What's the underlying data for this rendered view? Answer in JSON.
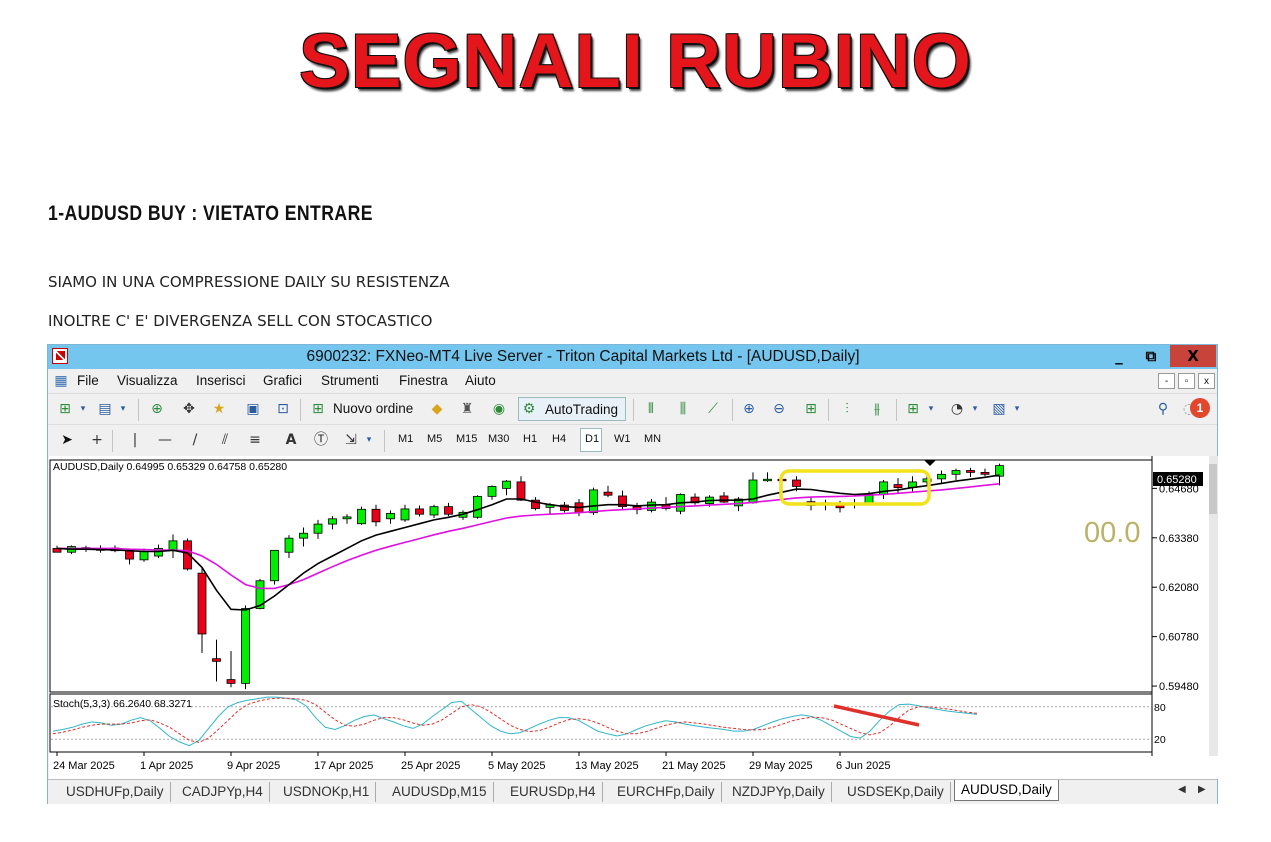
{
  "banner": "SEGNALI RUBINO",
  "heading": "1-AUDUSD BUY : VIETATO ENTRARE",
  "paragraphs": [
    "SIAMO IN UNA COMPRESSIONE DAILY SU RESISTENZA",
    "INOLTRE C' E' DIVERGENZA SELL CON STOCASTICO"
  ],
  "window": {
    "title": "6900232: FXNeo-MT4 Live Server - Triton Capital Markets Ltd - [AUDUSD,Daily]",
    "controls": {
      "minimize": "_",
      "restore": "⧉",
      "close": "X"
    },
    "menu": [
      "File",
      "Visualizza",
      "Inserisci",
      "Grafici",
      "Strumenti",
      "Finestra",
      "Aiuto"
    ],
    "mdi": {
      "minimize": "-",
      "restore": "▫",
      "close": "x"
    },
    "toolbar": {
      "new_order": "Nuovo ordine",
      "autotrading": "AutoTrading",
      "notification_count": "1"
    },
    "timeframes": [
      "M1",
      "M5",
      "M15",
      "M30",
      "H1",
      "H4",
      "D1",
      "W1",
      "MN"
    ],
    "active_timeframe": "D1",
    "tabs": [
      "USDHUFp,Daily",
      "CADJPYp,H4",
      "USDNOKp,H1",
      "AUDUSDp,M15",
      "EURUSDp,H4",
      "EURCHFp,Daily",
      "NZDJPYp,Daily",
      "USDSEKp,Daily",
      "AUDUSD,Daily"
    ],
    "active_tab": "AUDUSD,Daily"
  },
  "chart_data": {
    "type": "candlestick",
    "symbol_header": "AUDUSD,Daily  0.64995 0.65329 0.64758 0.65280",
    "current_price": "0.65280",
    "overlay_text": "00.0",
    "y_ticks": [
      "0.64680",
      "0.63380",
      "0.62080",
      "0.60780",
      "0.59480"
    ],
    "y_tick_values": [
      0.6468,
      0.6338,
      0.6208,
      0.6078,
      0.5948
    ],
    "ylim": [
      0.5935,
      0.654
    ],
    "x_labels": [
      "24 Mar 2025",
      "1 Apr 2025",
      "9 Apr 2025",
      "17 Apr 2025",
      "25 Apr 2025",
      "5 May 2025",
      "13 May 2025",
      "21 May 2025",
      "29 May 2025",
      "6 Jun 2025"
    ],
    "x_label_index": [
      0,
      6,
      12,
      18,
      24,
      30,
      36,
      42,
      48,
      54
    ],
    "candles": [
      [
        0.631,
        0.6317,
        0.63,
        0.63
      ],
      [
        0.63,
        0.6318,
        0.6295,
        0.6315
      ],
      [
        0.6307,
        0.6317,
        0.6301,
        0.6312
      ],
      [
        0.6305,
        0.6318,
        0.6299,
        0.631
      ],
      [
        0.6311,
        0.6318,
        0.63,
        0.6304
      ],
      [
        0.6304,
        0.6308,
        0.6268,
        0.6282
      ],
      [
        0.628,
        0.631,
        0.6275,
        0.6302
      ],
      [
        0.629,
        0.632,
        0.6285,
        0.631
      ],
      [
        0.6305,
        0.6347,
        0.6285,
        0.633
      ],
      [
        0.633,
        0.6336,
        0.6252,
        0.6256
      ],
      [
        0.6245,
        0.626,
        0.6035,
        0.6085
      ],
      [
        0.602,
        0.607,
        0.596,
        0.6013
      ],
      [
        0.5965,
        0.604,
        0.5945,
        0.5955
      ],
      [
        0.5955,
        0.616,
        0.594,
        0.6152
      ],
      [
        0.6152,
        0.623,
        0.615,
        0.6225
      ],
      [
        0.6225,
        0.63,
        0.6215,
        0.6305
      ],
      [
        0.63,
        0.6345,
        0.6285,
        0.6337
      ],
      [
        0.6337,
        0.6365,
        0.6315,
        0.635
      ],
      [
        0.635,
        0.6385,
        0.6335,
        0.6374
      ],
      [
        0.6374,
        0.6395,
        0.636,
        0.6388
      ],
      [
        0.6388,
        0.64,
        0.6375,
        0.6393
      ],
      [
        0.6375,
        0.642,
        0.6372,
        0.6413
      ],
      [
        0.6413,
        0.6425,
        0.6368,
        0.638
      ],
      [
        0.6388,
        0.641,
        0.6375,
        0.6402
      ],
      [
        0.6385,
        0.6425,
        0.638,
        0.6414
      ],
      [
        0.6414,
        0.6423,
        0.6394,
        0.64
      ],
      [
        0.6398,
        0.6425,
        0.639,
        0.642
      ],
      [
        0.642,
        0.643,
        0.6395,
        0.64
      ],
      [
        0.6392,
        0.641,
        0.6385,
        0.6405
      ],
      [
        0.6392,
        0.645,
        0.6388,
        0.6447
      ],
      [
        0.6447,
        0.6476,
        0.6438,
        0.6473
      ],
      [
        0.6468,
        0.649,
        0.645,
        0.6487
      ],
      [
        0.6485,
        0.65,
        0.6435,
        0.6437
      ],
      [
        0.6437,
        0.6445,
        0.641,
        0.6415
      ],
      [
        0.6418,
        0.643,
        0.64,
        0.6425
      ],
      [
        0.6424,
        0.6432,
        0.6405,
        0.641
      ],
      [
        0.643,
        0.644,
        0.6395,
        0.6405
      ],
      [
        0.6404,
        0.647,
        0.6398,
        0.6464
      ],
      [
        0.6458,
        0.6475,
        0.6445,
        0.645
      ],
      [
        0.6448,
        0.6462,
        0.641,
        0.642
      ],
      [
        0.642,
        0.643,
        0.64,
        0.6412
      ],
      [
        0.641,
        0.644,
        0.6405,
        0.6432
      ],
      [
        0.6425,
        0.6445,
        0.641,
        0.6415
      ],
      [
        0.6408,
        0.6455,
        0.64,
        0.6452
      ],
      [
        0.6445,
        0.6455,
        0.6425,
        0.643
      ],
      [
        0.6428,
        0.645,
        0.642,
        0.6445
      ],
      [
        0.6448,
        0.6458,
        0.643,
        0.6432
      ],
      [
        0.6422,
        0.6445,
        0.6408,
        0.644
      ],
      [
        0.643,
        0.651,
        0.6428,
        0.649
      ],
      [
        0.649,
        0.651,
        0.6485,
        0.6492
      ],
      [
        0.6492,
        0.6505,
        0.648,
        0.649
      ],
      [
        0.649,
        0.65,
        0.646,
        0.6473
      ],
      [
        0.6433,
        0.6445,
        0.641,
        0.6423
      ],
      [
        0.643,
        0.6438,
        0.641,
        0.6425
      ],
      [
        0.6425,
        0.6435,
        0.6405,
        0.6417
      ],
      [
        0.6425,
        0.644,
        0.6415,
        0.6428
      ],
      [
        0.6428,
        0.646,
        0.6425,
        0.6452
      ],
      [
        0.6452,
        0.649,
        0.644,
        0.6485
      ],
      [
        0.6478,
        0.6495,
        0.6455,
        0.647
      ],
      [
        0.647,
        0.65,
        0.646,
        0.6485
      ],
      [
        0.6485,
        0.6505,
        0.6475,
        0.6493
      ],
      [
        0.6493,
        0.6515,
        0.648,
        0.6505
      ],
      [
        0.6505,
        0.652,
        0.649,
        0.6515
      ],
      [
        0.6515,
        0.6522,
        0.6498,
        0.651
      ],
      [
        0.651,
        0.652,
        0.65,
        0.6505
      ],
      [
        0.65,
        0.6533,
        0.6476,
        0.6528
      ]
    ],
    "ma_black": [
      0.631,
      0.6308,
      0.6308,
      0.6307,
      0.6306,
      0.6304,
      0.6302,
      0.6302,
      0.6305,
      0.6298,
      0.626,
      0.62,
      0.615,
      0.6148,
      0.616,
      0.6185,
      0.6215,
      0.6245,
      0.627,
      0.629,
      0.631,
      0.633,
      0.6345,
      0.6355,
      0.6365,
      0.6375,
      0.6385,
      0.6392,
      0.64,
      0.6412,
      0.6425,
      0.644,
      0.644,
      0.6432,
      0.6425,
      0.642,
      0.6418,
      0.6422,
      0.6425,
      0.6425,
      0.6422,
      0.6424,
      0.6425,
      0.643,
      0.6432,
      0.6436,
      0.6437,
      0.6437,
      0.644,
      0.645,
      0.6458,
      0.6466,
      0.6465,
      0.646,
      0.6455,
      0.6452,
      0.6454,
      0.646,
      0.6464,
      0.647,
      0.6475,
      0.6481,
      0.6487,
      0.6492,
      0.6497,
      0.6503
    ],
    "ma_magenta": [
      0.631,
      0.631,
      0.631,
      0.631,
      0.631,
      0.6308,
      0.6307,
      0.6306,
      0.6306,
      0.6304,
      0.629,
      0.6268,
      0.624,
      0.6215,
      0.6205,
      0.6205,
      0.6215,
      0.6228,
      0.6245,
      0.6262,
      0.6278,
      0.6292,
      0.6305,
      0.6316,
      0.6326,
      0.6336,
      0.6346,
      0.6355,
      0.6363,
      0.6372,
      0.6381,
      0.639,
      0.6395,
      0.6398,
      0.64,
      0.6402,
      0.6404,
      0.6407,
      0.641,
      0.6412,
      0.6414,
      0.6416,
      0.6418,
      0.642,
      0.6422,
      0.6424,
      0.6426,
      0.6428,
      0.6431,
      0.6435,
      0.6439,
      0.6443,
      0.6445,
      0.6446,
      0.6447,
      0.6448,
      0.645,
      0.6452,
      0.6455,
      0.6458,
      0.6461,
      0.6464,
      0.6468,
      0.6472,
      0.6476,
      0.648
    ],
    "stoch": {
      "label": "Stoch(5,3,3) 66.2640 68.3271",
      "levels": [
        80,
        20
      ],
      "main": [
        35,
        38,
        42,
        48,
        52,
        50,
        46,
        48,
        55,
        60,
        54,
        40,
        25,
        15,
        8,
        18,
        40,
        62,
        80,
        88,
        92,
        95,
        98,
        98,
        96,
        93,
        82,
        60,
        42,
        38,
        45,
        55,
        62,
        65,
        58,
        52,
        45,
        40,
        48,
        62,
        75,
        88,
        90,
        75,
        60,
        45,
        35,
        30,
        32,
        40,
        48,
        55,
        60,
        60,
        55,
        45,
        35,
        30,
        26,
        30,
        38,
        45,
        50,
        54,
        52,
        48,
        45,
        42,
        40,
        38,
        35,
        35,
        38,
        45,
        52,
        58,
        62,
        65,
        62,
        55,
        45,
        35,
        25,
        22,
        35,
        55,
        72,
        84,
        85,
        82,
        78,
        75,
        72,
        70,
        68,
        66
      ],
      "signal": [
        30,
        33,
        37,
        42,
        46,
        48,
        48,
        48,
        50,
        54,
        56,
        50,
        42,
        30,
        18,
        14,
        22,
        38,
        55,
        72,
        84,
        90,
        94,
        96,
        96,
        95,
        92,
        84,
        70,
        56,
        46,
        44,
        48,
        55,
        60,
        60,
        56,
        50,
        46,
        48,
        56,
        68,
        80,
        84,
        80,
        70,
        58,
        46,
        38,
        34,
        36,
        42,
        50,
        56,
        58,
        56,
        50,
        42,
        35,
        30,
        30,
        34,
        40,
        46,
        50,
        52,
        50,
        48,
        45,
        42,
        40,
        38,
        37,
        38,
        42,
        48,
        54,
        58,
        61,
        60,
        56,
        48,
        40,
        32,
        28,
        32,
        44,
        60,
        74,
        80,
        80,
        78,
        76,
        73,
        70,
        68
      ]
    }
  }
}
